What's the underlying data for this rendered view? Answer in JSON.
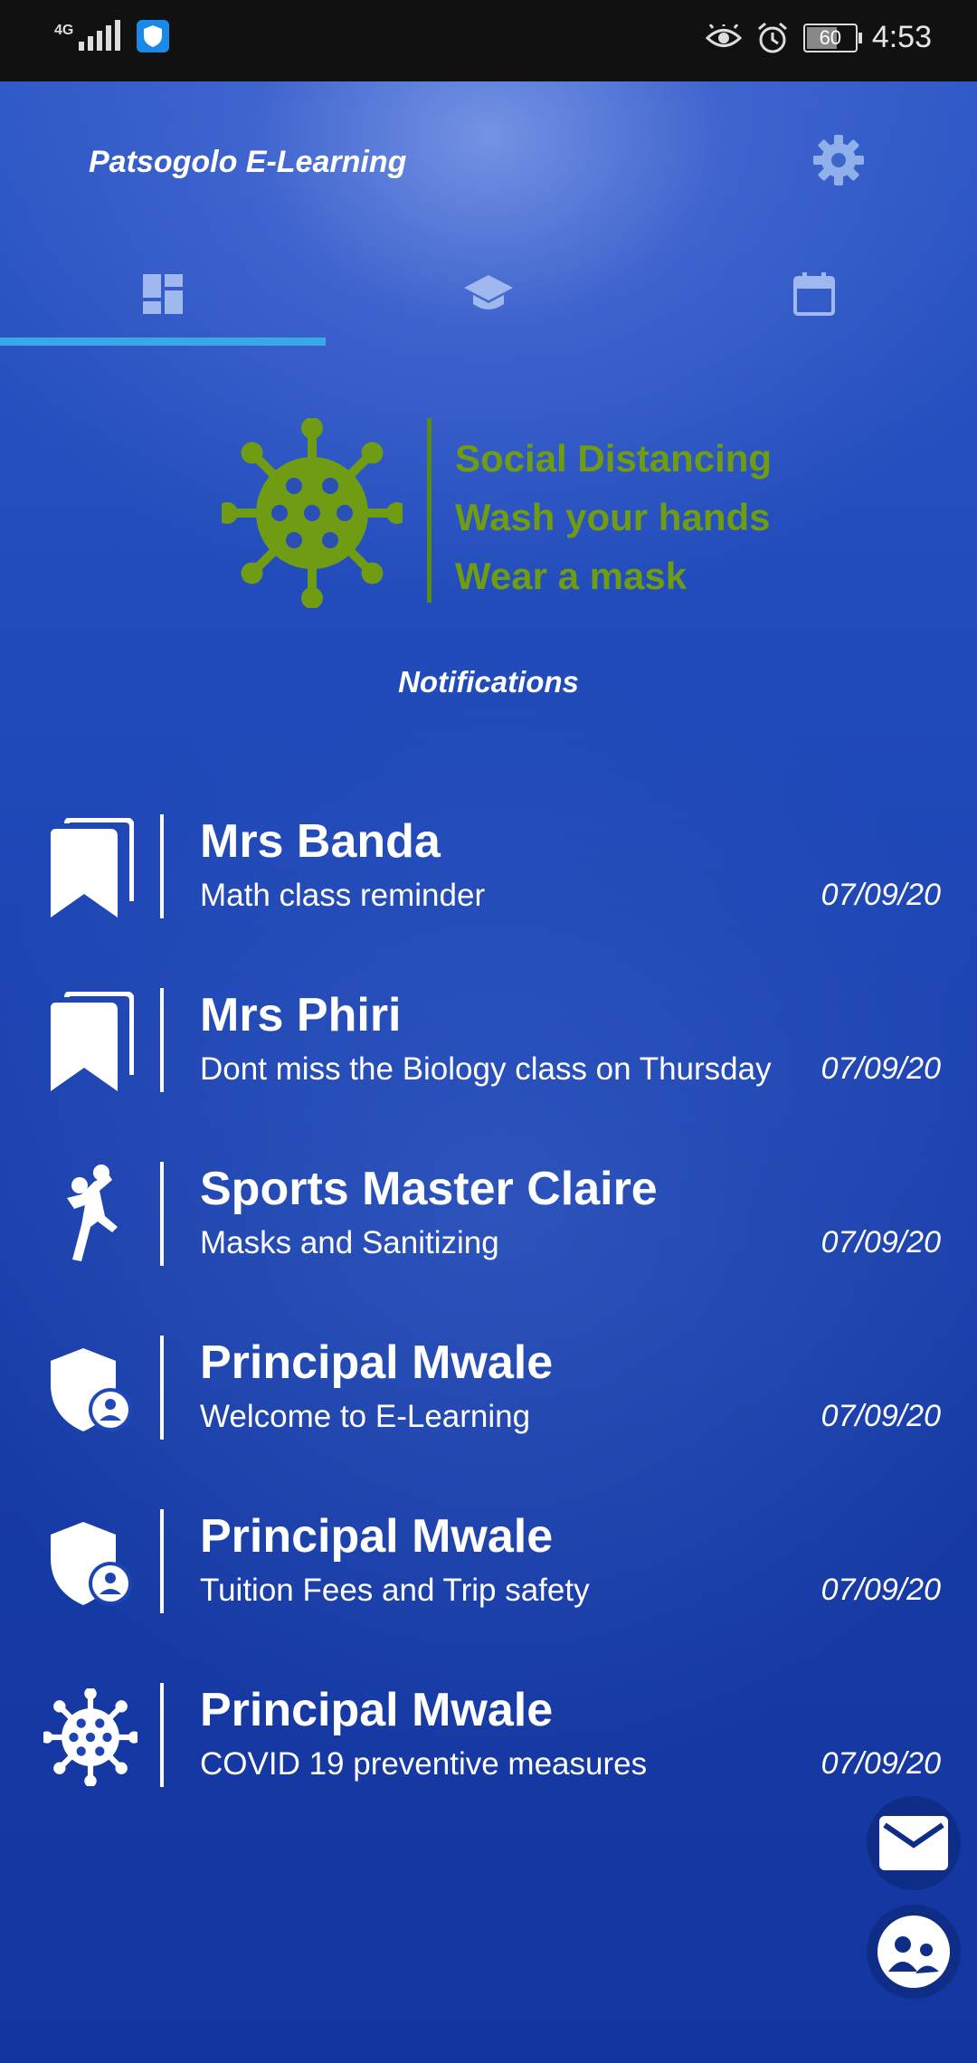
{
  "status_bar": {
    "network": "4G",
    "battery": "60",
    "time": "4:53"
  },
  "header": {
    "title": "Patsogolo E-Learning"
  },
  "tabs": [
    {
      "icon": "dashboard-icon",
      "active": true
    },
    {
      "icon": "graduation-cap-icon",
      "active": false
    },
    {
      "icon": "calendar-icon",
      "active": false
    }
  ],
  "banner": {
    "lines": [
      "Social Distancing",
      "Wash your hands",
      "Wear a mask"
    ],
    "color": "#6f9c12"
  },
  "notifications": {
    "title": "Notifications",
    "items": [
      {
        "icon": "bookmarks-icon",
        "name": "Mrs Banda",
        "message": "Math class reminder",
        "date": "07/09/20"
      },
      {
        "icon": "bookmarks-icon",
        "name": "Mrs Phiri",
        "message": "Dont miss the Biology class on Thursday",
        "date": "07/09/20"
      },
      {
        "icon": "sports-handball-icon",
        "name": "Sports Master Claire",
        "message": "Masks and Sanitizing",
        "date": "07/09/20"
      },
      {
        "icon": "admin-shield-icon",
        "name": "Principal Mwale",
        "message": "Welcome to E-Learning",
        "date": "07/09/20"
      },
      {
        "icon": "admin-shield-icon",
        "name": "Principal Mwale",
        "message": "Tuition Fees and Trip safety",
        "date": "07/09/20"
      },
      {
        "icon": "virus-icon",
        "name": "Principal Mwale",
        "message": "COVID 19 preventive measures",
        "date": "07/09/20"
      }
    ]
  },
  "colors": {
    "accent": "#39a8e8",
    "background": "#1a3aa3",
    "banner_green": "#6f9c12"
  }
}
